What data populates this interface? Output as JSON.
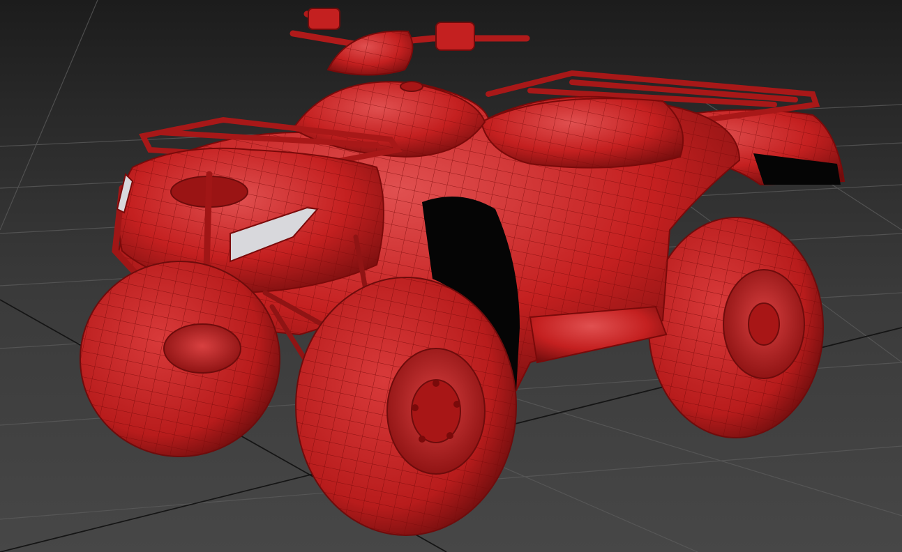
{
  "viewport": {
    "background_top": "#1c1c1c",
    "background_bottom": "#474747",
    "grid_color": "#5c5c5c",
    "grid_axis_color": "#151515"
  },
  "model": {
    "subject": "atv-quad-bike",
    "display_mode": "shaded-with-wireframe-edges",
    "body_color": "#c42020",
    "shadow_color": "#6e0c0c",
    "highlight_color": "#e05050",
    "wire_color": "#7a0a0a",
    "headlight_color": "#d8d8dc",
    "opening_color": "#050505"
  }
}
